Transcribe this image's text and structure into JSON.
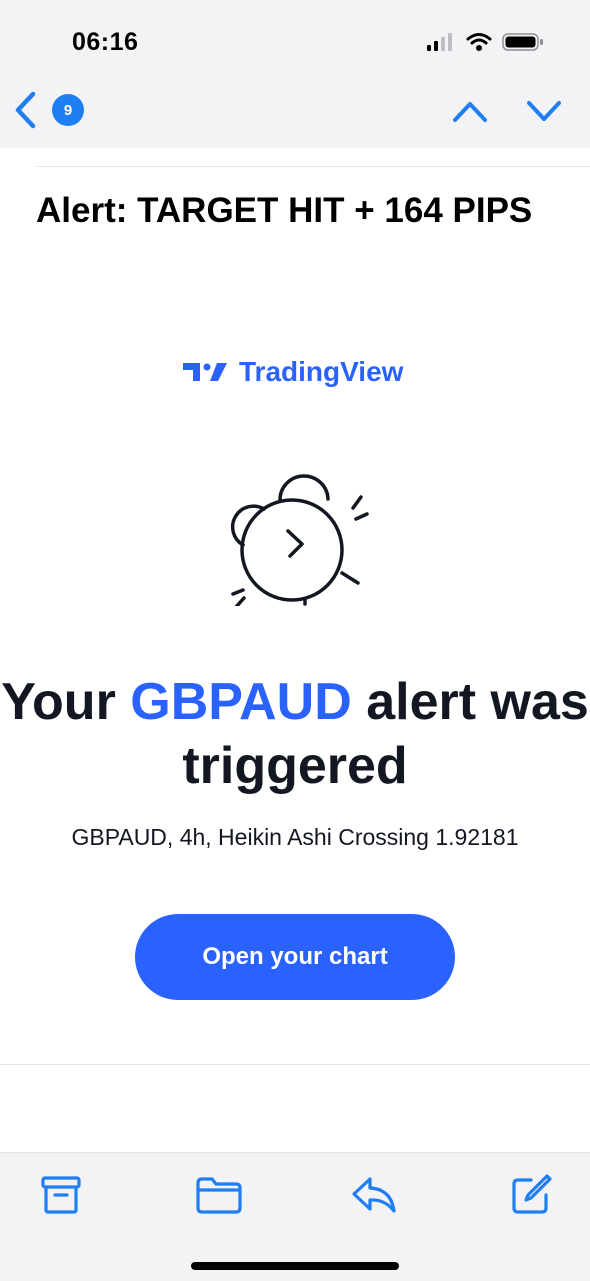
{
  "status_bar": {
    "time": "06:16",
    "icons": [
      "cellular-signal-icon",
      "wifi-icon",
      "battery-icon"
    ]
  },
  "nav": {
    "back_badge_count": "9",
    "icons": [
      "back-chevron-icon",
      "previous-message-icon",
      "next-message-icon"
    ]
  },
  "email": {
    "subject": "Alert: TARGET HIT + 164 PIPS",
    "brand_name": "TradingView",
    "headline_prefix": "Your",
    "headline_symbol": "GBPAUD",
    "headline_suffix": "alert was triggered",
    "detail": "GBPAUD, 4h, Heikin Ashi Crossing 1.92181",
    "cta_label": "Open your chart"
  },
  "toolbar": {
    "icons": [
      "archive-icon",
      "folder-icon",
      "reply-icon",
      "compose-icon"
    ]
  },
  "colors": {
    "accent": "#1f7ef2",
    "brand": "#2962ff",
    "text": "#131722",
    "bar_bg": "#f3f3f5"
  }
}
